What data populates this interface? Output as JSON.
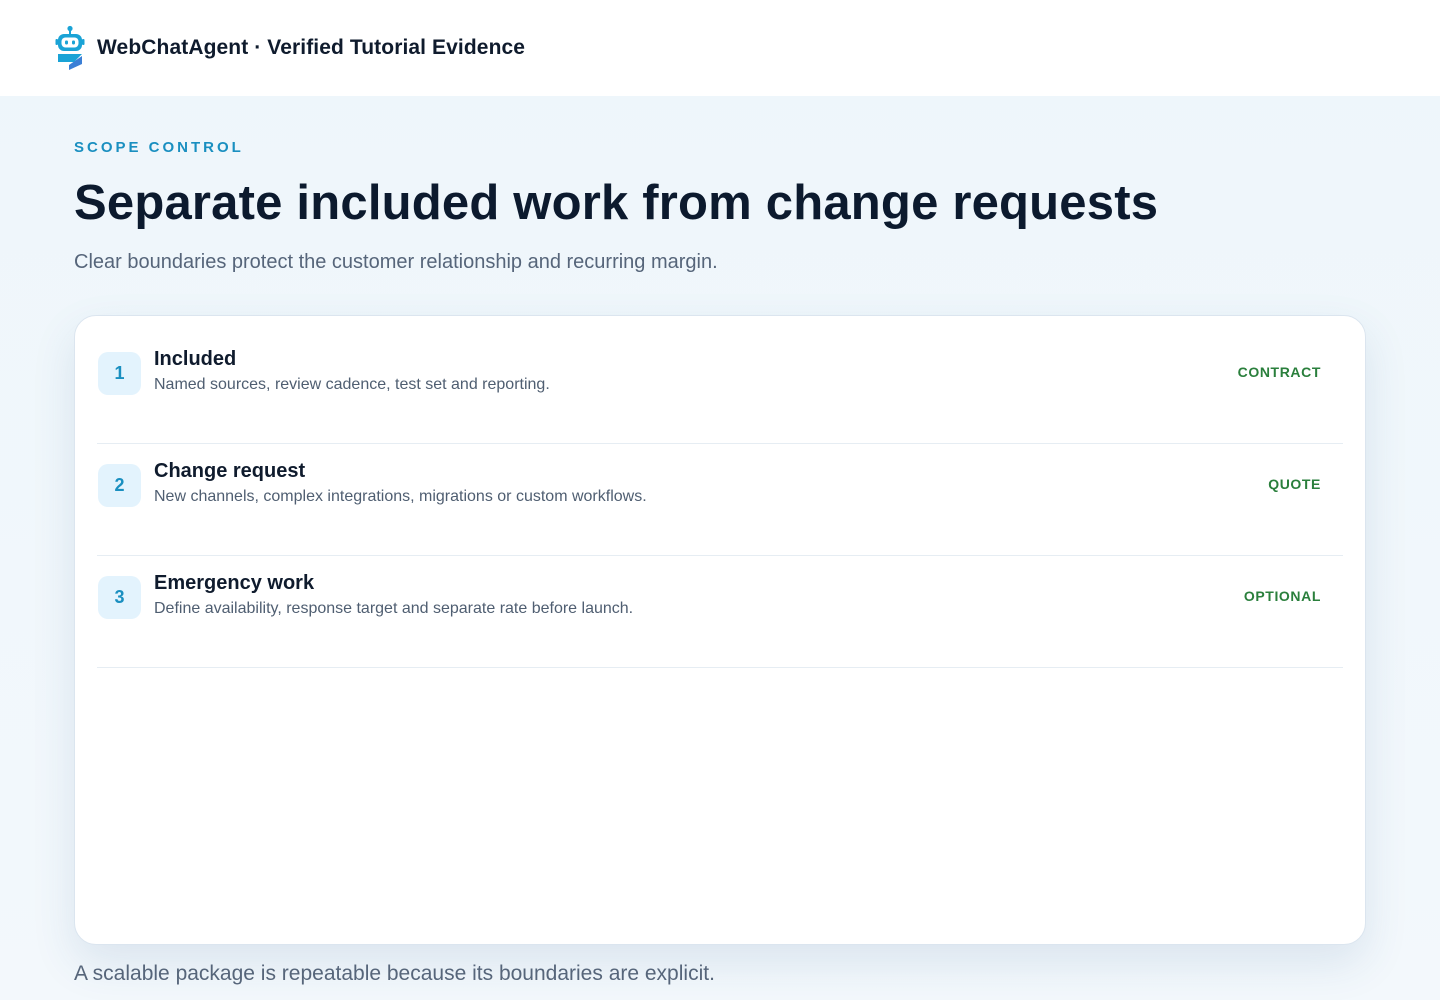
{
  "header": {
    "brand": "WebChatAgent · Verified Tutorial Evidence",
    "logo_icon": "robot-logo-icon"
  },
  "main": {
    "eyebrow": "SCOPE CONTROL",
    "title": "Separate included work from change requests",
    "subtitle": "Clear boundaries protect the customer relationship and recurring margin.",
    "items": [
      {
        "number": "1",
        "title": "Included",
        "description": "Named sources, review cadence, test set and reporting.",
        "tag": "CONTRACT"
      },
      {
        "number": "2",
        "title": "Change request",
        "description": "New channels, complex integrations, migrations or custom workflows.",
        "tag": "QUOTE"
      },
      {
        "number": "3",
        "title": "Emergency work",
        "description": "Define availability, response target and separate rate before launch.",
        "tag": "OPTIONAL"
      }
    ],
    "footer_note": "A scalable package is repeatable because its boundaries are explicit."
  },
  "colors": {
    "accent": "#1a8fc0",
    "tag": "#2a7f3c",
    "heading": "#0c1a2e",
    "muted": "#56657a",
    "background": "#eef6fb"
  }
}
